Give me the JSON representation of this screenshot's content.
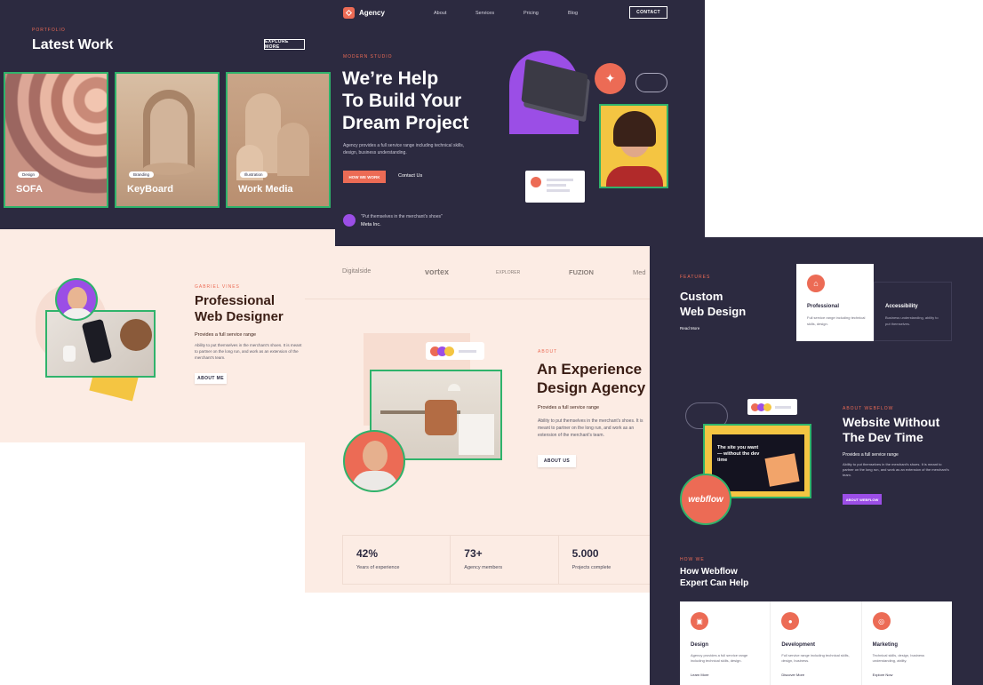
{
  "portfolio": {
    "eyebrow": "PORTFOLIO",
    "title": "Latest Work",
    "explore": "EXPLORE MORE",
    "cards": [
      {
        "tag": "Design",
        "title": "SOFA"
      },
      {
        "tag": "Branding",
        "title": "KeyBoard"
      },
      {
        "tag": "Illustration",
        "title": "Work Media"
      }
    ]
  },
  "profile": {
    "eyebrow": "GABRIEL VINES",
    "title_line1": "Professional",
    "title_line2": "Web Designer",
    "subtitle": "Provides a full service range",
    "body": "Ability to put themselves in the merchant's shoes. It is meant to partner on the long run, and work as an extension of the merchant's team.",
    "button": "ABOUT ME"
  },
  "hero": {
    "brand": "Agency",
    "nav": [
      "About",
      "Services",
      "Pricing",
      "Blog"
    ],
    "contact": "CONTACT",
    "eyebrow": "MODERN STUDIO",
    "title_line1": "We’re Help",
    "title_line2": "To Build Your",
    "title_line3": "Dream Project",
    "body": "Agency provides a full service range including technical skills, design, business understanding.",
    "primary": "HOW WE WORK",
    "secondary": "Contact Us",
    "quote": "\"Put themselves in the merchant's shoes\"",
    "quote_author": "Meta Inc."
  },
  "logos": [
    "Digitalside",
    "vortex",
    "EXPLORER",
    "FUZION",
    "Med"
  ],
  "about": {
    "eyebrow": "ABOUT",
    "title_line1": "An Experience",
    "title_line2": "Design Agency",
    "subtitle": "Provides a full service range",
    "body": "Ability to put themselves in the merchant's shoes. It is meant to partner on the long run, and work as an extension of the merchant's team.",
    "button": "ABOUT US"
  },
  "stats": [
    {
      "value": "42%",
      "label": "Years of experience"
    },
    {
      "value": "73+",
      "label": "Agency members"
    },
    {
      "value": "5.000",
      "label": "Projects complete"
    }
  ],
  "features": {
    "eyebrow": "FEATURES",
    "title_line1": "Custom",
    "title_line2": "Web Design",
    "read_more": "Read More",
    "cards": [
      {
        "title": "Professional",
        "body": "Full service range including technical skills, design."
      },
      {
        "title": "Accessibility",
        "body": "Business understanding, ability to put themselves."
      }
    ]
  },
  "webflow": {
    "eyebrow": "ABOUT WEBFLOW",
    "title_line1": "Website Without",
    "title_line2": "The Dev Time",
    "subtitle": "Provides a full service range",
    "body": "Ability to put themselves in the merchant's shoes. It is meant to partner on the long run, and work as an extension of the merchant's team.",
    "button": "ABOUT WEBFLOW",
    "mock_text": "The site you want — without the dev time",
    "badge": "webflow"
  },
  "services": {
    "eyebrow": "HOW WE",
    "title_line1": "How Webflow",
    "title_line2": "Expert Can Help",
    "cards": [
      {
        "title": "Design",
        "body": "Agency provides a full service range including technical skills, design.",
        "link": "Learn More"
      },
      {
        "title": "Development",
        "body": "Full service range including technical skills, design, business.",
        "link": "Discover More"
      },
      {
        "title": "Marketing",
        "body": "Technical skills, design, business understanding, ability.",
        "link": "Explore Now"
      }
    ]
  },
  "colors": {
    "dark": "#2c2a40",
    "accent": "#ec6b55",
    "purple": "#9b4ee6",
    "green": "#2fb36b",
    "yellow": "#f4c542"
  }
}
